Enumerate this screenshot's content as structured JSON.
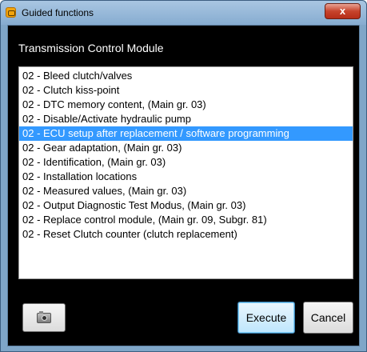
{
  "window": {
    "title": "Guided functions",
    "close_glyph": "x"
  },
  "module_title": "Transmission Control Module",
  "functions": {
    "items": [
      "02 - Bleed clutch/valves",
      "02 - Clutch kiss-point",
      "02 - DTC memory content, (Main gr. 03)",
      "02 - Disable/Activate hydraulic pump",
      "02 - ECU setup after replacement / software programming",
      "02 - Gear adaptation, (Main gr. 03)",
      "02 - Identification, (Main gr. 03)",
      "02 - Installation locations",
      "02 - Measured values, (Main gr. 03)",
      "02 - Output Diagnostic Test Modus, (Main gr. 03)",
      "02 - Replace control module, (Main gr. 09, Subgr. 81)",
      "02 - Reset Clutch counter (clutch replacement)"
    ],
    "selected_index": 4
  },
  "buttons": {
    "camera_icon": "camera-icon",
    "execute_label": "Execute",
    "cancel_label": "Cancel"
  },
  "colors": {
    "selection": "#3399ff",
    "dialog_background": "#000000",
    "title_bar": "#9bbcdc"
  }
}
